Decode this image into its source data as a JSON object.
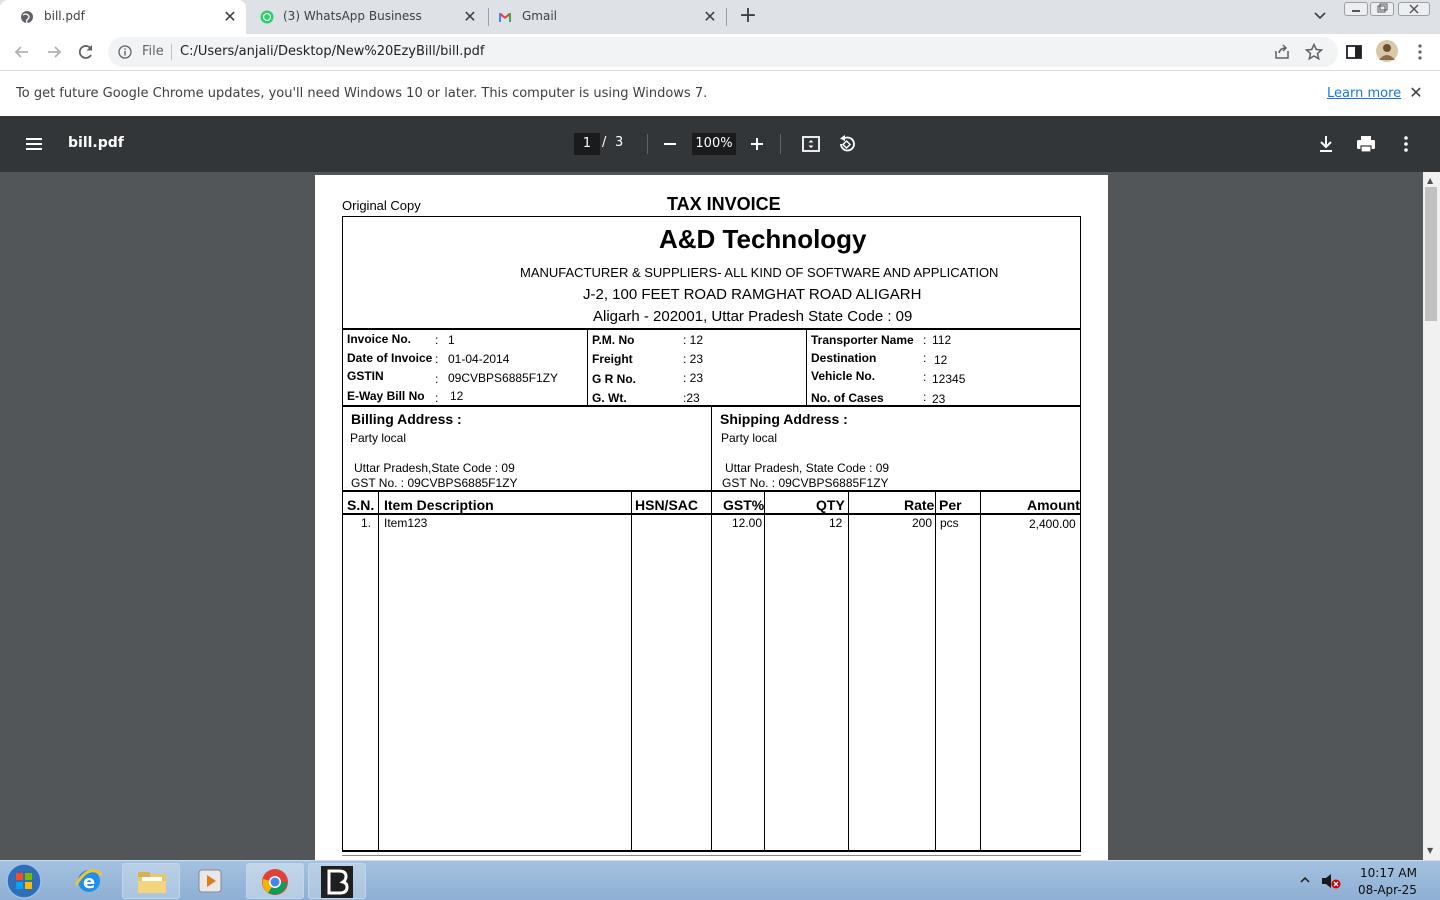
{
  "tabs": [
    {
      "title": "bill.pdf",
      "icon": "globe-icon",
      "close_label": "✕"
    },
    {
      "title": "(3) WhatsApp Business",
      "icon": "whatsapp-icon",
      "close_label": "✕"
    },
    {
      "title": "Gmail",
      "icon": "gmail-icon",
      "close_label": "✕"
    }
  ],
  "newtab_label": "+",
  "omnibox": {
    "scheme": "File",
    "url": "C:/Users/anjali/Desktop/New%20EzyBill/bill.pdf"
  },
  "infobar": {
    "message": "To get future Google Chrome updates, you'll need Windows 10 or later. This computer is using Windows 7.",
    "link": "Learn more",
    "close_label": "✕"
  },
  "pdf_toolbar": {
    "title": "bill.pdf",
    "page_current": "1",
    "page_sep": "/",
    "page_total": "3",
    "zoom": "100%"
  },
  "invoice": {
    "copy_label": "Original Copy",
    "title": "TAX INVOICE",
    "company": "A&D Technology",
    "tagline": "MANUFACTURER & SUPPLIERS- ALL KIND OF SOFTWARE AND APPLICATION",
    "address1": "J-2, 100 FEET ROAD RAMGHAT ROAD ALIGARH",
    "address2": "Aligarh - 202001, Uttar Pradesh State Code : 09",
    "info_col1": [
      {
        "label": "Invoice No.",
        "colon": ":",
        "value": "1"
      },
      {
        "label": "Date of Invoice",
        "colon": ":",
        "value": "01-04-2014"
      },
      {
        "label": "GSTIN",
        "colon": ":",
        "value": "09CVBPS6885F1ZY"
      },
      {
        "label": "E-Way Bill No",
        "colon": ":",
        "value": "12"
      }
    ],
    "info_col2": [
      {
        "label": "P.M. No",
        "value": ": 12"
      },
      {
        "label": "Freight",
        "value": ": 23"
      },
      {
        "label": "G R No.",
        "value": ": 23"
      },
      {
        "label": "G. Wt.",
        "value": ":23"
      }
    ],
    "info_col3": [
      {
        "label": "Transporter Name",
        "colon": ":",
        "value": "112"
      },
      {
        "label": "Destination",
        "colon": ":",
        "value": "12"
      },
      {
        "label": "Vehicle No.",
        "colon": ":",
        "value": "12345"
      },
      {
        "label": "No. of Cases",
        "colon": ":",
        "value": "23"
      }
    ],
    "billing": {
      "heading": "Billing Address :",
      "party": "Party local",
      "state": "Uttar Pradesh,State Code : 09",
      "gst": "GST No. : 09CVBPS6885F1ZY"
    },
    "shipping": {
      "heading": "Shipping Address :",
      "party": "Party local",
      "state": "Uttar Pradesh, State Code : 09",
      "gst": "GST No. : 09CVBPS6885F1ZY"
    },
    "table_headers": [
      "S.N.",
      "Item Description",
      "HSN/SAC",
      "GST%",
      "QTY",
      "Rate",
      "Per",
      "Amount"
    ],
    "rows": [
      [
        "1.",
        "Item123",
        "",
        "12.00",
        "12",
        "200",
        "pcs",
        "2,400.00"
      ]
    ]
  },
  "taskbar": {
    "time": "10:17 AM",
    "date": "08-Apr-25"
  }
}
